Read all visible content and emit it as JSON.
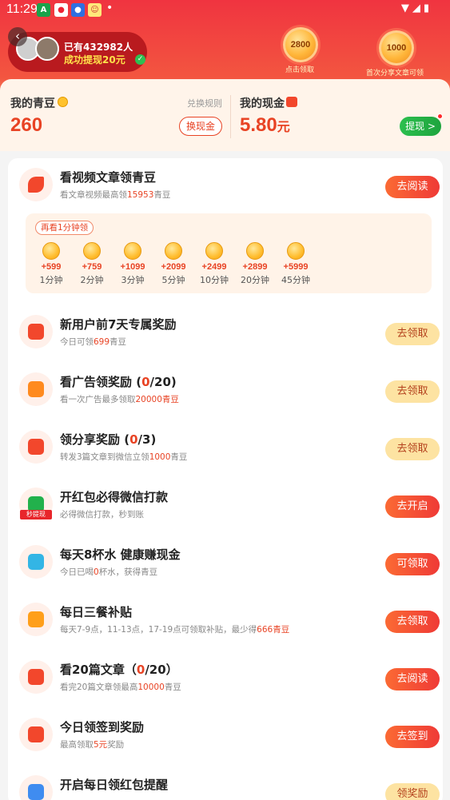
{
  "status_bar": {
    "time": "11:29"
  },
  "header": {
    "back_icon": "chevron-left-icon",
    "notice_line1": "已有432982人",
    "notice_line2": "成功提现20元",
    "coin1_value": "2800",
    "coin1_caption": "点击领取",
    "coin2_value": "1000",
    "coin2_caption": "首次分享文章可领"
  },
  "wallet": {
    "beans_label": "我的青豆",
    "rules_link": "兑换规则",
    "beans_value": "260",
    "exchange_button": "换现金",
    "cash_label": "我的现金",
    "cash_value": "5.80",
    "cash_unit": "元",
    "withdraw_button": "提现 >"
  },
  "video_task": {
    "title": "看视频文章领青豆",
    "sub_prefix": "看文章视频最高领",
    "sub_value": "15953",
    "sub_suffix": "青豆",
    "button": "去阅读",
    "panel_tag": "再看1分钟领",
    "slots": [
      {
        "amount": "+599",
        "duration": "1分钟"
      },
      {
        "amount": "+759",
        "duration": "2分钟"
      },
      {
        "amount": "+1099",
        "duration": "3分钟"
      },
      {
        "amount": "+2099",
        "duration": "5分钟"
      },
      {
        "amount": "+2499",
        "duration": "10分钟"
      },
      {
        "amount": "+2899",
        "duration": "20分钟"
      },
      {
        "amount": "+5999",
        "duration": "45分钟"
      }
    ]
  },
  "tasks": [
    {
      "title": "新用户前7天专属奖励",
      "title_hl": "",
      "title_end": "",
      "sub_prefix": "今日可领",
      "sub_hl": "699",
      "sub_suffix": "青豆",
      "button": "去领取",
      "style": "yellow",
      "icon": "red-envelope-icon"
    },
    {
      "title": "看广告领奖励 (",
      "title_hl": "0",
      "title_end": "/20)",
      "sub_prefix": "看一次广告最多领取",
      "sub_hl": "20000青豆",
      "sub_suffix": "",
      "button": "去领取",
      "style": "yellow",
      "icon": "play-icon"
    },
    {
      "title": "领分享奖励 (",
      "title_hl": "0",
      "title_end": "/3)",
      "sub_prefix": "转发3篇文章到微信立领",
      "sub_hl": "1000",
      "sub_suffix": "青豆",
      "button": "去领取",
      "style": "yellow",
      "icon": "share-arrow-icon"
    },
    {
      "title": "开红包必得微信打款",
      "title_hl": "",
      "title_end": "",
      "sub_prefix": "必得微信打款，秒到账",
      "sub_hl": "",
      "sub_suffix": "",
      "button": "去开启",
      "style": "red",
      "icon": "wechat-pay-icon",
      "icon_tag": "秒提现"
    },
    {
      "title": "每天8杯水 健康赚现金",
      "title_hl": "",
      "title_end": "",
      "sub_prefix": "今日已喝",
      "sub_hl": "0",
      "sub_suffix": "杯水，获得青豆",
      "button": "可领取",
      "style": "red",
      "icon": "water-cup-icon"
    },
    {
      "title": "每日三餐补贴",
      "title_hl": "",
      "title_end": "",
      "sub_prefix": "每天7-9点，11-13点，17-19点可领取补贴，最少得",
      "sub_hl": "666青豆",
      "sub_suffix": "",
      "button": "去领取",
      "style": "red",
      "icon": "rice-bowl-icon"
    },
    {
      "title": "看20篇文章（",
      "title_hl": "0",
      "title_end": "/20）",
      "sub_prefix": "看完20篇文章领最高",
      "sub_hl": "10000",
      "sub_suffix": "青豆",
      "button": "去阅读",
      "style": "red",
      "icon": "red-envelope-icon"
    },
    {
      "title": "今日领签到奖励",
      "title_hl": "",
      "title_end": "",
      "sub_prefix": "最高领取",
      "sub_hl": "5元",
      "sub_suffix": "奖励",
      "button": "去签到",
      "style": "red",
      "icon": "red-envelope-icon"
    },
    {
      "title": "开启每日领红包提醒",
      "title_hl": "",
      "title_end": "",
      "sub_prefix": "",
      "sub_hl": "",
      "sub_suffix": "",
      "button": "领奖励",
      "style": "yellow",
      "icon": "bell-icon"
    }
  ],
  "colors": {
    "accent": "#e84324",
    "header": "#f03440",
    "withdraw": "#2cbf4e"
  }
}
